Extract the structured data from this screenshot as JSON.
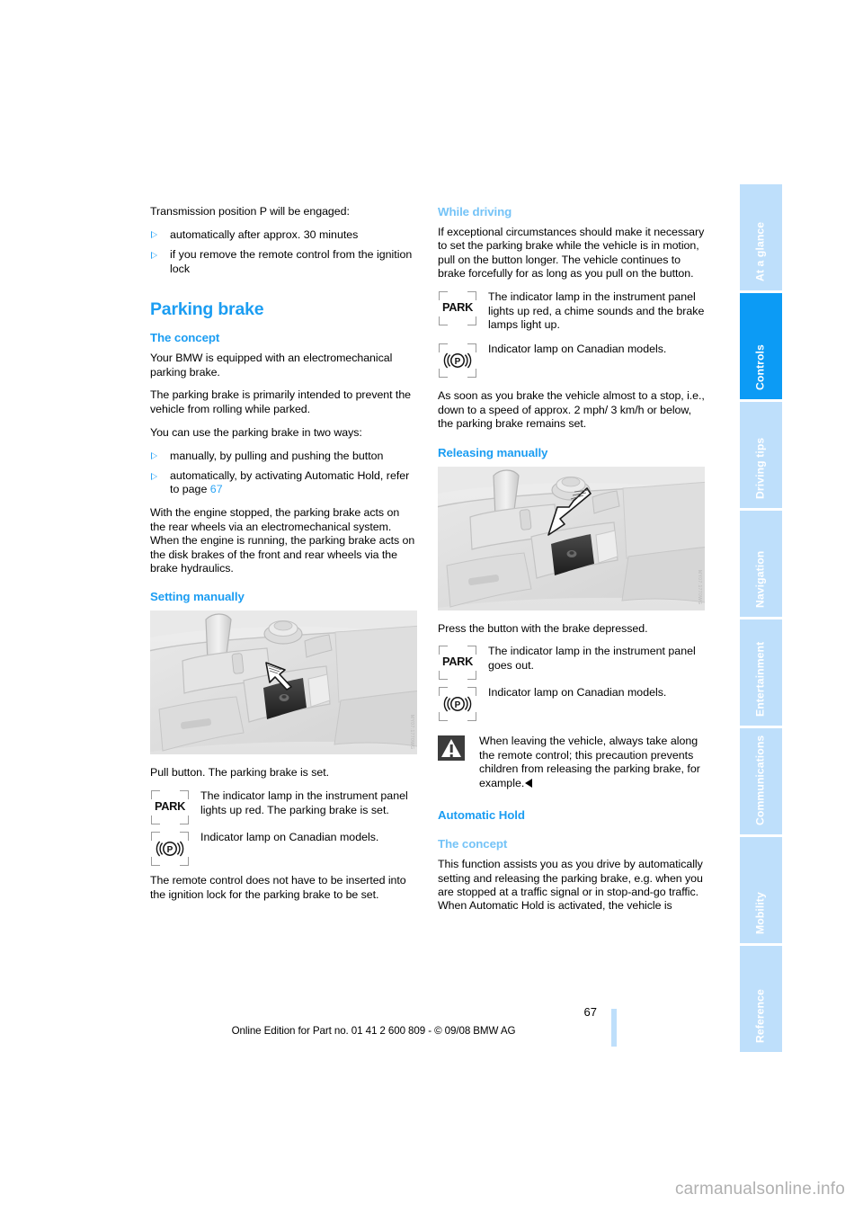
{
  "document": {
    "page_number": "67",
    "footer_text": "Online Edition for Part no. 01 41 2 600 809 - © 09/08 BMW AG",
    "watermark": "carmanualsonline.info",
    "accent_blue": "#1b9df2",
    "tab_active_blue": "#0c9bf5",
    "tab_inactive_blue": "#bedffb"
  },
  "sidebar": {
    "tabs": [
      {
        "label": "At a glance",
        "active": false
      },
      {
        "label": "Controls",
        "active": true
      },
      {
        "label": "Driving tips",
        "active": false
      },
      {
        "label": "Navigation",
        "active": false
      },
      {
        "label": "Entertainment",
        "active": false
      },
      {
        "label": "Communications",
        "active": false
      },
      {
        "label": "Mobility",
        "active": false
      },
      {
        "label": "Reference",
        "active": false
      }
    ]
  },
  "left_column": {
    "intro_lead": "Transmission position P will be engaged:",
    "intro_bullets": [
      "automatically after approx. 30 minutes",
      "if you remove the remote control from the ignition lock"
    ],
    "section_title": "Parking brake",
    "concept_heading": "The concept",
    "concept_p1": "Your BMW is equipped with an electromechanical parking brake.",
    "concept_p2": "The parking brake is primarily intended to prevent the vehicle from rolling while parked.",
    "concept_p3": "You can use the parking brake in two ways:",
    "ways_bullet_1": "manually, by pulling and pushing the button",
    "ways_bullet_2_pre": "automatically, by activating Automatic Hold, refer to page ",
    "ways_bullet_2_link": "67",
    "concept_p4": "With the engine stopped, the parking brake acts on the rear wheels via an electromechanical system. When the engine is running, the parking brake acts on the disk brakes of the front and rear wheels via the brake hydraulics.",
    "setting_heading": "Setting manually",
    "figure_caption": "Pull button. The parking brake is set.",
    "figure_code": "MY07:1770WG",
    "symbol_rows": [
      {
        "icon": "park-indicator-icon",
        "icon_text": "PARK",
        "text": "The indicator lamp in the instrument panel lights up red. The parking brake is set."
      },
      {
        "icon": "canadian-p-indicator-icon",
        "icon_text": "(P)",
        "text": "Indicator lamp on Canadian models."
      }
    ],
    "closing_p": "The remote control does not have to be inserted into the ignition lock for the parking brake to be set."
  },
  "right_column": {
    "driving_heading": "While driving",
    "driving_p1": "If exceptional circumstances should make it necessary to set the parking brake while the vehicle is in motion, pull on the button longer. The vehicle continues to brake forcefully for as long as you pull on the button.",
    "driving_symbol_rows": [
      {
        "icon": "park-indicator-icon",
        "icon_text": "PARK",
        "text": "The indicator lamp in the instrument panel lights up red, a chime sounds and the brake lamps light up."
      },
      {
        "icon": "canadian-p-indicator-icon",
        "icon_text": "(P)",
        "text": "Indicator lamp on Canadian models."
      }
    ],
    "driving_p2": "As soon as you brake the vehicle almost to a stop, i.e., down to a speed of approx. 2 mph/ 3 km/h or below, the parking brake remains set.",
    "releasing_heading": "Releasing manually",
    "figure_caption": "Press the button with the brake depressed.",
    "figure_code": "MY07:1770WG",
    "releasing_symbol_rows": [
      {
        "icon": "park-indicator-icon",
        "icon_text": "PARK",
        "text": "The indicator lamp  in the instrument panel goes out."
      },
      {
        "icon": "canadian-p-indicator-icon",
        "icon_text": "(P)",
        "text": "Indicator lamp on Canadian models."
      }
    ],
    "warning_text": "When leaving the vehicle, always take along the remote control; this precaution prevents children from releasing the parking brake, for example.",
    "auto_hold_heading": "Automatic Hold",
    "auto_hold_concept_heading": "The concept",
    "auto_hold_p1": "This function assists you as you drive by automatically setting and releasing the parking brake, e.g. when you are stopped at a traffic signal or in stop-and-go traffic.",
    "auto_hold_p2": "When Automatic Hold is activated, the vehicle is"
  }
}
